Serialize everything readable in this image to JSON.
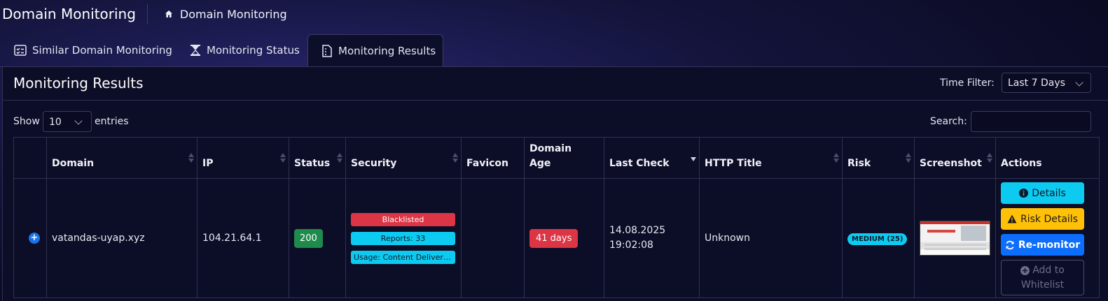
{
  "header": {
    "title": "Domain Monitoring",
    "breadcrumb": "Domain Monitoring"
  },
  "tabs": [
    {
      "label": "Similar Domain Monitoring",
      "icon": "checklist-icon",
      "active": false
    },
    {
      "label": "Monitoring Status",
      "icon": "hourglass-icon",
      "active": false
    },
    {
      "label": "Monitoring Results",
      "icon": "document-icon",
      "active": true
    }
  ],
  "card": {
    "title": "Monitoring Results",
    "time_filter_label": "Time Filter:",
    "time_filter_value": "Last 7 Days"
  },
  "table_controls": {
    "show_label": "Show",
    "entries_value": "10",
    "entries_label": "entries",
    "search_label": "Search:",
    "search_value": ""
  },
  "columns": [
    "",
    "Domain",
    "IP",
    "Status",
    "Security",
    "Favicon",
    "Domain Age",
    "Last Check",
    "HTTP Title",
    "Risk",
    "Screenshot",
    "Actions"
  ],
  "sorted_column": "Last Check",
  "rows": [
    {
      "domain": "vatandas-uyap.xyz",
      "ip": "104.21.64.1",
      "status": "200",
      "security": [
        "Blacklisted",
        "Reports: 33",
        "Usage: Content Delivery Network"
      ],
      "favicon": "",
      "domain_age": "41 days",
      "last_check_date": "14.08.2025",
      "last_check_time": "19:02:08",
      "http_title": "Unknown",
      "risk": "MEDIUM (25)",
      "actions": {
        "details": "Details",
        "risk_details": "Risk Details",
        "remonitor": "Re-monitor",
        "whitelist_line1": "Add to",
        "whitelist_line2": "Whitelist"
      }
    }
  ],
  "colors": {
    "cyan": "#0dcaf0",
    "red": "#dc3545",
    "yellow": "#ffc107",
    "blue": "#0d6efd",
    "green": "#1e8a4c"
  }
}
